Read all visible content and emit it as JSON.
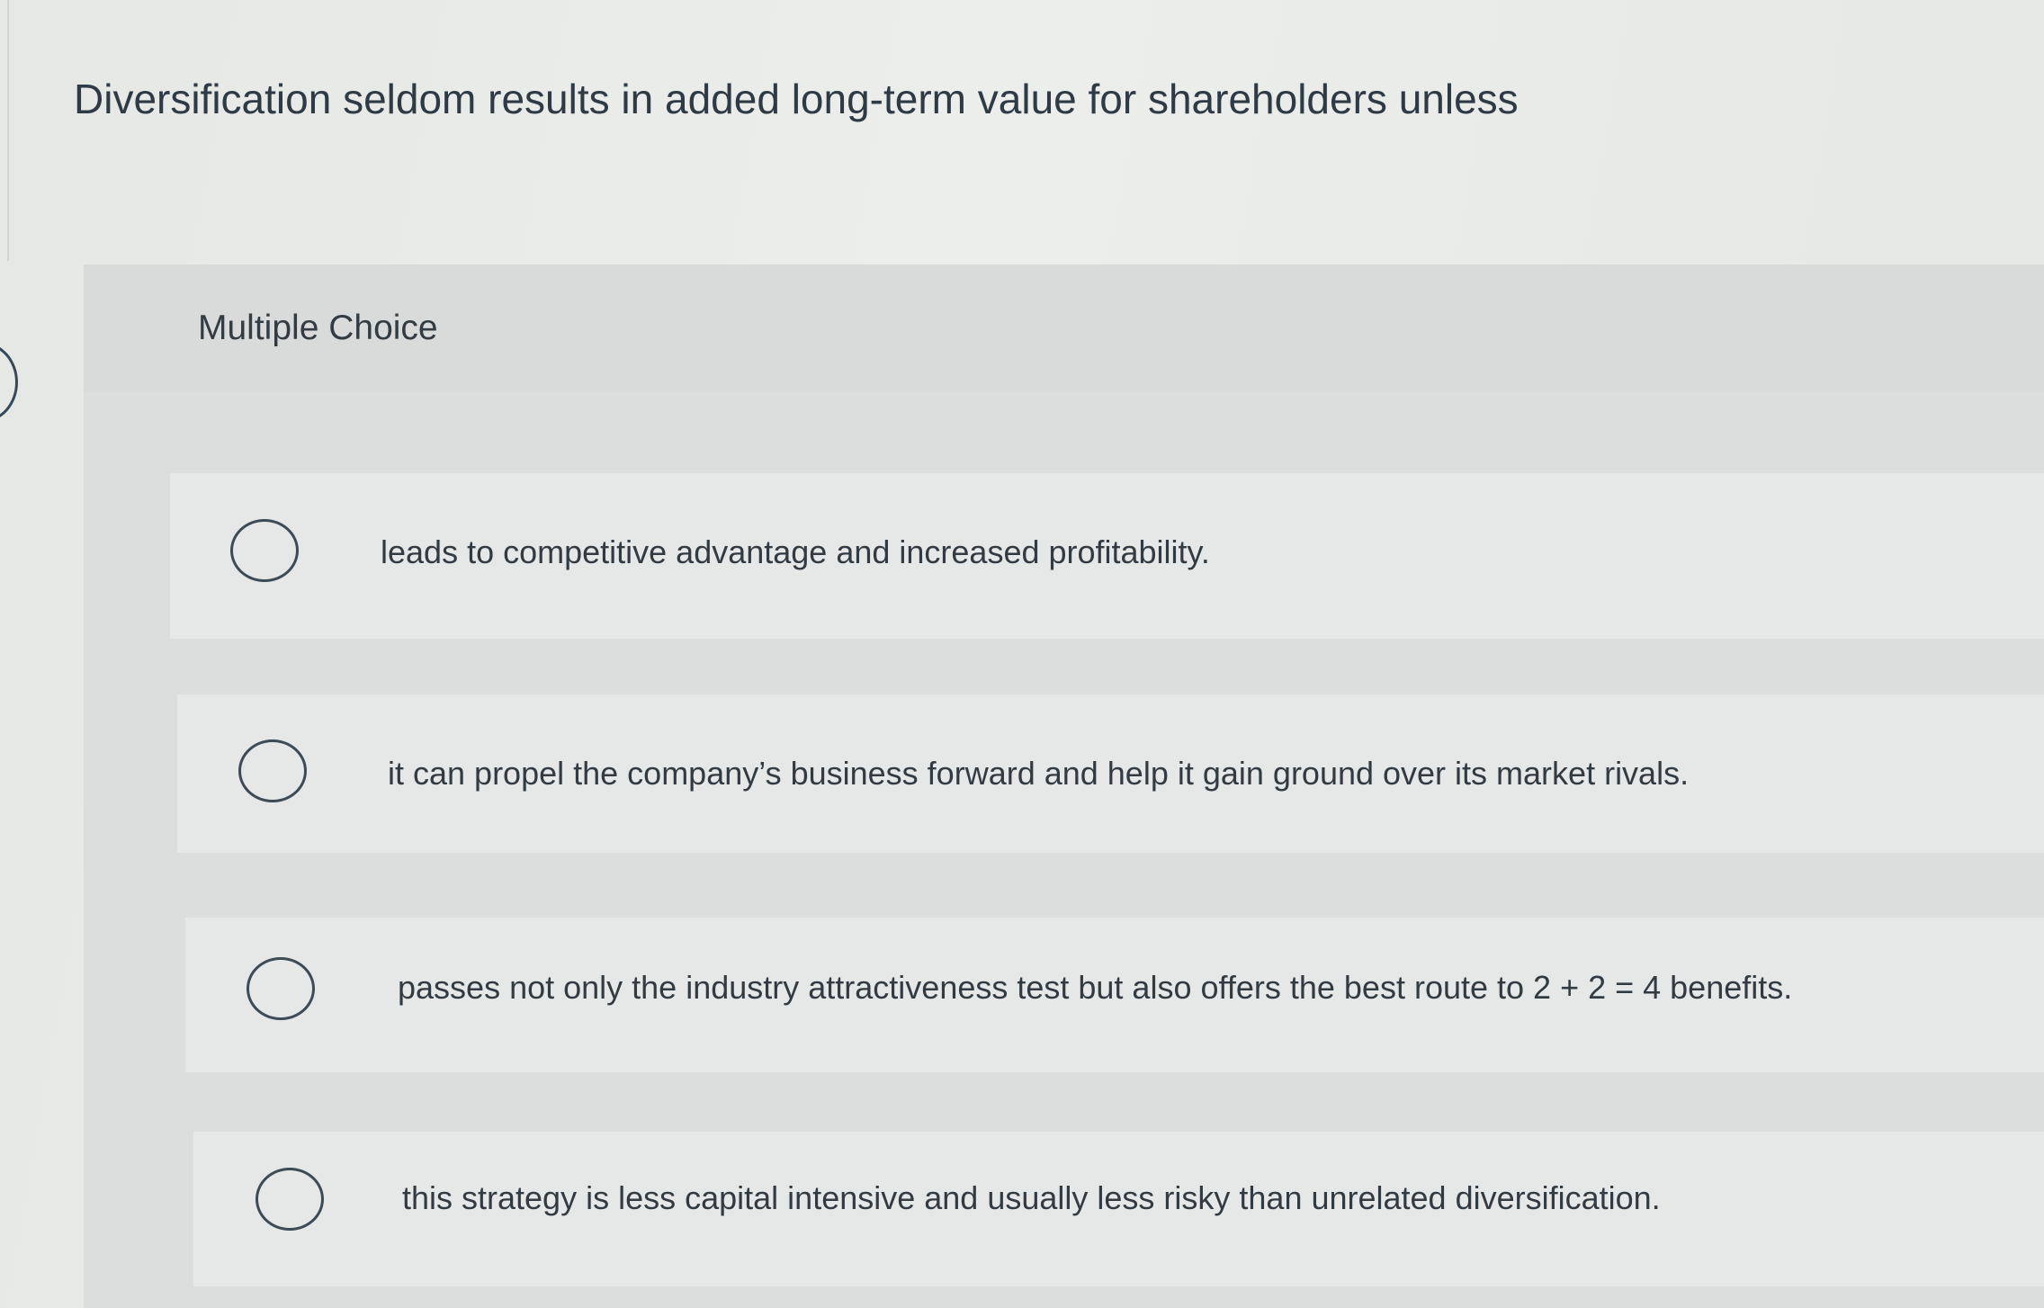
{
  "question": {
    "text": "Diversification seldom results in added long-term value for shareholders unless"
  },
  "panel": {
    "header_label": "Multiple Choice",
    "choices": [
      {
        "text": "leads to competitive advantage and increased profitability.",
        "selected": false
      },
      {
        "text": "it can propel the company’s business forward and help it gain ground over its market rivals.",
        "selected": false
      },
      {
        "text": "passes not only the industry attractiveness test but also offers the best route to 2 + 2 = 4 benefits.",
        "selected": false
      },
      {
        "text": "this strategy is less capital intensive and usually less risky than unrelated diversification.",
        "selected": false
      }
    ]
  }
}
